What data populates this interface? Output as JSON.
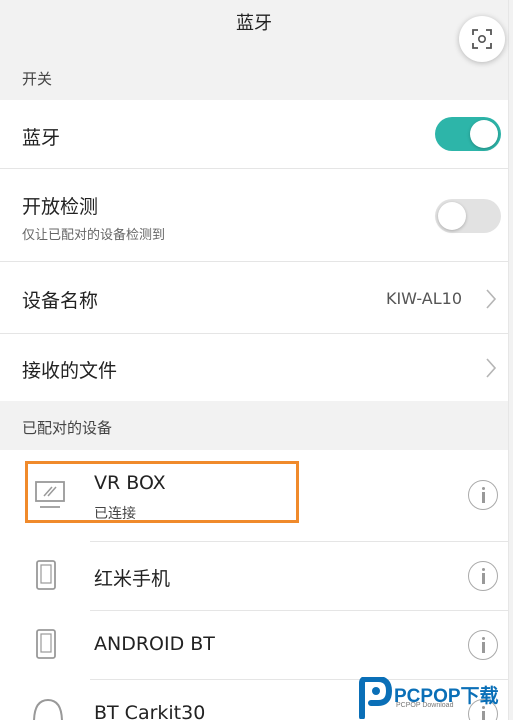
{
  "header": {
    "title": "蓝牙"
  },
  "sections": {
    "switch": "开关",
    "paired": "已配对的设备"
  },
  "bluetooth": {
    "label": "蓝牙",
    "enabled": true
  },
  "discoverable": {
    "label": "开放检测",
    "sublabel": "仅让已配对的设备检测到",
    "enabled": false
  },
  "device_name": {
    "label": "设备名称",
    "value": "KIW-AL10"
  },
  "received_files": {
    "label": "接收的文件"
  },
  "paired_devices": [
    {
      "name": "VR BOX",
      "status": "已连接",
      "icon": "display-icon"
    },
    {
      "name": "红米手机",
      "status": "",
      "icon": "phone-icon"
    },
    {
      "name": "ANDROID BT",
      "status": "",
      "icon": "phone-icon"
    },
    {
      "name": "BT Carkit30",
      "status": "",
      "icon": "headset-icon"
    }
  ],
  "watermark": {
    "brand": "PCPOP下载",
    "sub": "PCPOP Download"
  },
  "colors": {
    "accent": "#2db5a9",
    "highlight": "#f08a2b",
    "brand": "#0a6fb7"
  }
}
